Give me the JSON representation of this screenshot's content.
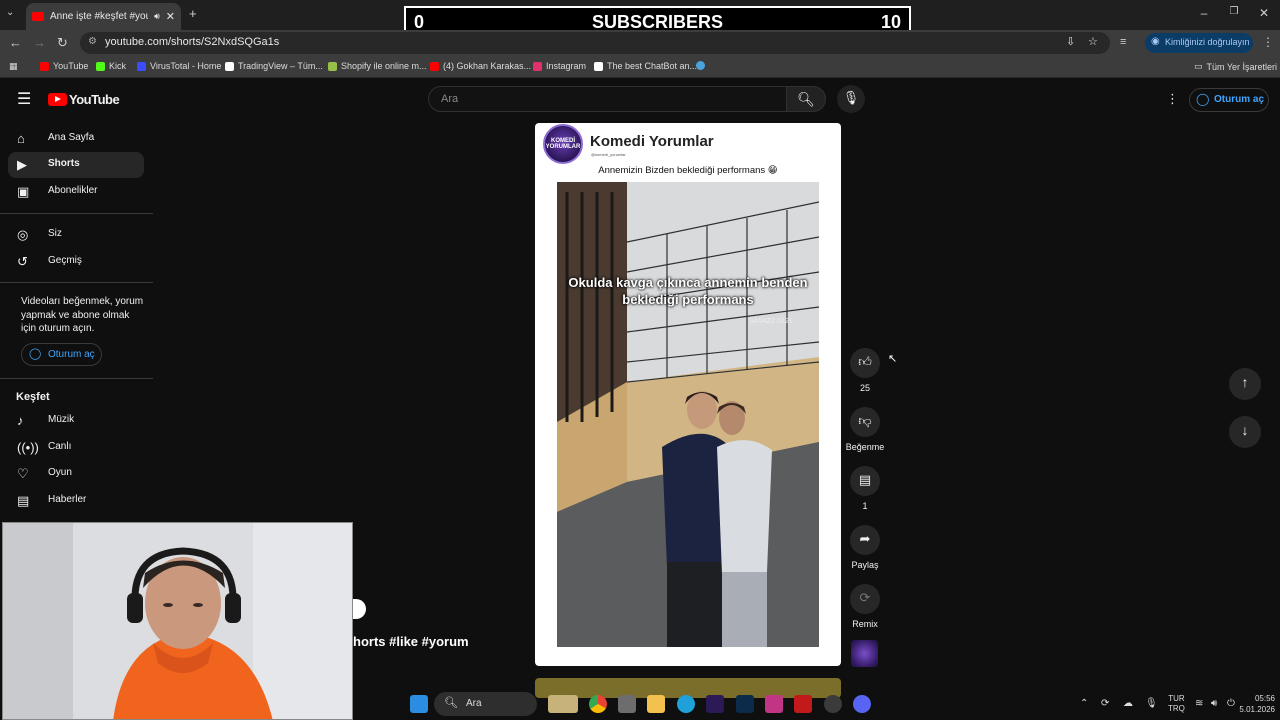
{
  "browser": {
    "tab_title": "Anne işte #keşfet #youtube",
    "url": "youtube.com/shorts/S2NxdSQGa1s",
    "verify_label": "Kimliğinizi doğrulayın",
    "all_bookmarks": "Tüm Yer İşaretleri",
    "bookmarks": [
      {
        "label": "YouTube",
        "color": "#ff0000"
      },
      {
        "label": "Kick",
        "color": "#53fc18"
      },
      {
        "label": "VirusTotal - Home",
        "color": "#394eff"
      },
      {
        "label": "TradingView – Tüm...",
        "color": "#ffffff"
      },
      {
        "label": "Shopify ile online m...",
        "color": "#95bf47"
      },
      {
        "label": "(4) Gokhan Karakas...",
        "color": "#ff0000"
      },
      {
        "label": "Instagram",
        "color": "#e1306c"
      },
      {
        "label": "The best ChatBot an...",
        "color": "#ffffff"
      }
    ]
  },
  "overlay": {
    "left": "0",
    "center": "SUBSCRIBERS",
    "right": "10"
  },
  "youtube": {
    "logo": "YouTube",
    "search_placeholder": "Ara",
    "signin": "Oturum aç",
    "sidebar": {
      "items": [
        {
          "label": "Ana Sayfa",
          "icon": "home-icon"
        },
        {
          "label": "Shorts",
          "icon": "shorts-icon",
          "active": true
        },
        {
          "label": "Abonelikler",
          "icon": "subscriptions-icon"
        }
      ],
      "you_items": [
        {
          "label": "Siz",
          "icon": "person-icon"
        },
        {
          "label": "Geçmiş",
          "icon": "history-icon"
        }
      ],
      "prompt": "Videoları beğenmek, yorum yapmak ve abone olmak için oturum açın.",
      "signin": "Oturum aç",
      "explore_title": "Keşfet",
      "explore_items": [
        {
          "label": "Müzik",
          "icon": "music-icon"
        },
        {
          "label": "Canlı",
          "icon": "live-icon"
        },
        {
          "label": "Oyun",
          "icon": "gaming-icon"
        },
        {
          "label": "Haberler",
          "icon": "news-icon"
        }
      ]
    },
    "short": {
      "channel_name": "Komedi Yorumlar",
      "channel_handle": "@komedi_yorumlar",
      "avatar_text": "KOMEDİ YORUMLAR",
      "caption": "Annemizin Bizden beklediği  performans 😁",
      "video_overlay_text": "Okulda kavga çıkınca annemin benden beklediği performans",
      "watermark": "SAYAZZ.0121",
      "title_fragment": "horts #like #yorum"
    },
    "actions": {
      "likes": "25",
      "dislike": "Beğenme",
      "comments": "1",
      "share": "Paylaş",
      "remix": "Remix"
    }
  },
  "taskbar": {
    "search": "Ara",
    "lang_top": "TUR",
    "lang_bottom": "TRQ",
    "time": "05:56",
    "date": "5.01.2026"
  }
}
